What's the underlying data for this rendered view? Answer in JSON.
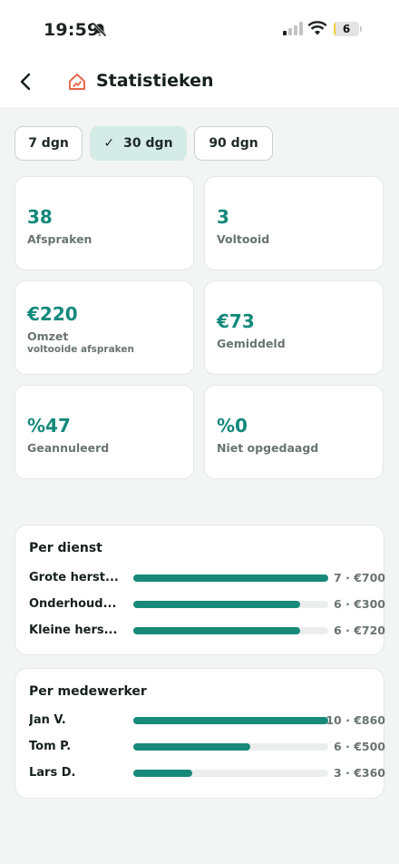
{
  "status_bar": {
    "time": "19:59",
    "battery": "6",
    "battery_level": 0.06
  },
  "header": {
    "title": "Statistieken",
    "back_icon": "chevron-left-icon",
    "title_icon": "house-chart-icon",
    "accent": "#e8644a"
  },
  "period_filter": {
    "options": [
      {
        "label": "7 dgn",
        "selected": false
      },
      {
        "label": "30 dgn",
        "selected": true
      },
      {
        "label": "90 dgn",
        "selected": false
      }
    ]
  },
  "stats": [
    {
      "value": "38",
      "label": "Afspraken",
      "sublabel": ""
    },
    {
      "value": "3",
      "label": "Voltooid",
      "sublabel": ""
    },
    {
      "value": "€220",
      "label": "Omzet",
      "sublabel": "voltooide afspraken"
    },
    {
      "value": "€73",
      "label": "Gemiddeld",
      "sublabel": ""
    },
    {
      "value": "%47",
      "label": "Geannuleerd",
      "sublabel": ""
    },
    {
      "value": "%0",
      "label": "Niet opgedaagd",
      "sublabel": ""
    }
  ],
  "per_service": {
    "title": "Per dienst",
    "rows": [
      {
        "name": "Grote herst...",
        "fraction": 1.0,
        "value": "7 · €700"
      },
      {
        "name": "Onderhoud...",
        "fraction": 0.857,
        "value": "6 · €300"
      },
      {
        "name": "Kleine hers...",
        "fraction": 0.857,
        "value": "6 · €720"
      }
    ]
  },
  "per_employee": {
    "title": "Per medewerker",
    "rows": [
      {
        "name": "Jan V.",
        "fraction": 1.0,
        "value": "10 · €860"
      },
      {
        "name": "Tom P.",
        "fraction": 0.6,
        "value": "6 · €500"
      },
      {
        "name": "Lars D.",
        "fraction": 0.3,
        "value": "3 · €360"
      }
    ]
  },
  "colors": {
    "accent": "#14897b",
    "bar": "#178a7a",
    "selected_chip": "#d4ebe6"
  }
}
